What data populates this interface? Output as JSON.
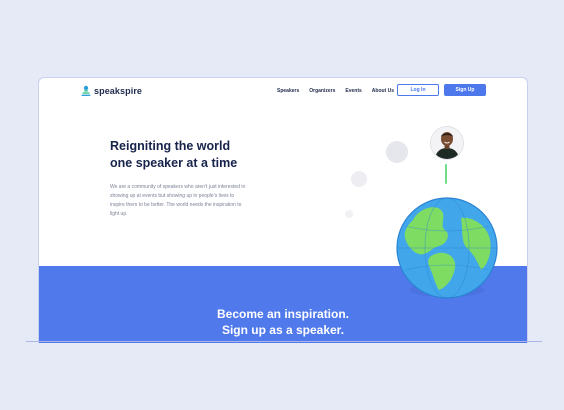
{
  "brand": {
    "name": "speakspire"
  },
  "nav": {
    "links": [
      "Speakers",
      "Organizers",
      "Events",
      "About Us"
    ],
    "login_label": "Log In",
    "signup_label": "Sign Up"
  },
  "hero": {
    "title_line1": "Reigniting the world",
    "title_line2": "one speaker at a time",
    "description": "We are a community of speakers who aren’t just interested in showing up at events but showing up in people’s lives to inspire them to be better. The world needs the inspiration to light up."
  },
  "cta": {
    "line1": "Become an inspiration.",
    "line2": "Sign up as a speaker."
  },
  "icons": {
    "logo": "speaker-microphone-icon",
    "avatar": "speaker-avatar",
    "globe": "globe-illustration"
  },
  "colors": {
    "accent": "#4c78ec",
    "band": "#5079eb",
    "title": "#16234a",
    "connector": "#6fdc8a"
  }
}
